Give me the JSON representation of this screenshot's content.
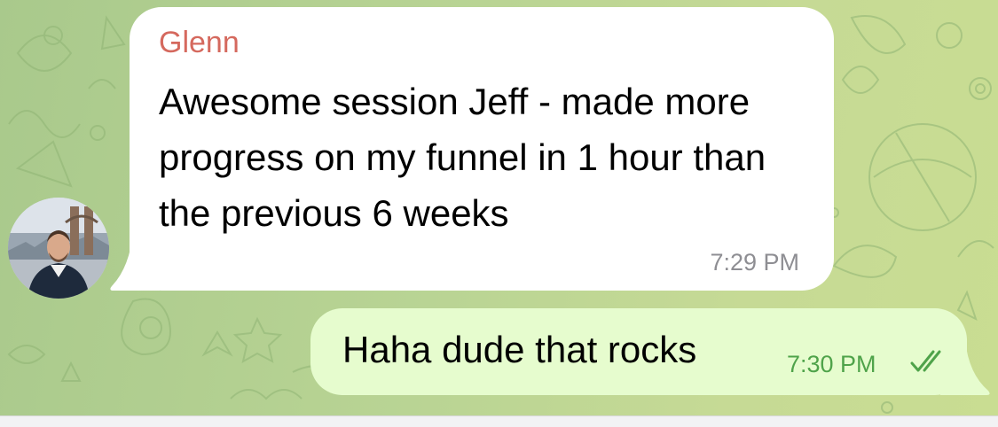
{
  "chat": {
    "incoming": {
      "sender": "Glenn",
      "text": "Awesome session Jeff - made more progress on my funnel in 1 hour than the previous 6 weeks",
      "time": "7:29 PM",
      "sender_color": "#d5695e"
    },
    "outgoing": {
      "text": "Haha dude that rocks",
      "time": "7:30 PM",
      "status_icon": "double-check-icon",
      "time_color": "#4fa34a"
    },
    "colors": {
      "incoming_bubble": "#ffffff",
      "outgoing_bubble": "#e6fcce",
      "background": "#b9d494"
    }
  }
}
